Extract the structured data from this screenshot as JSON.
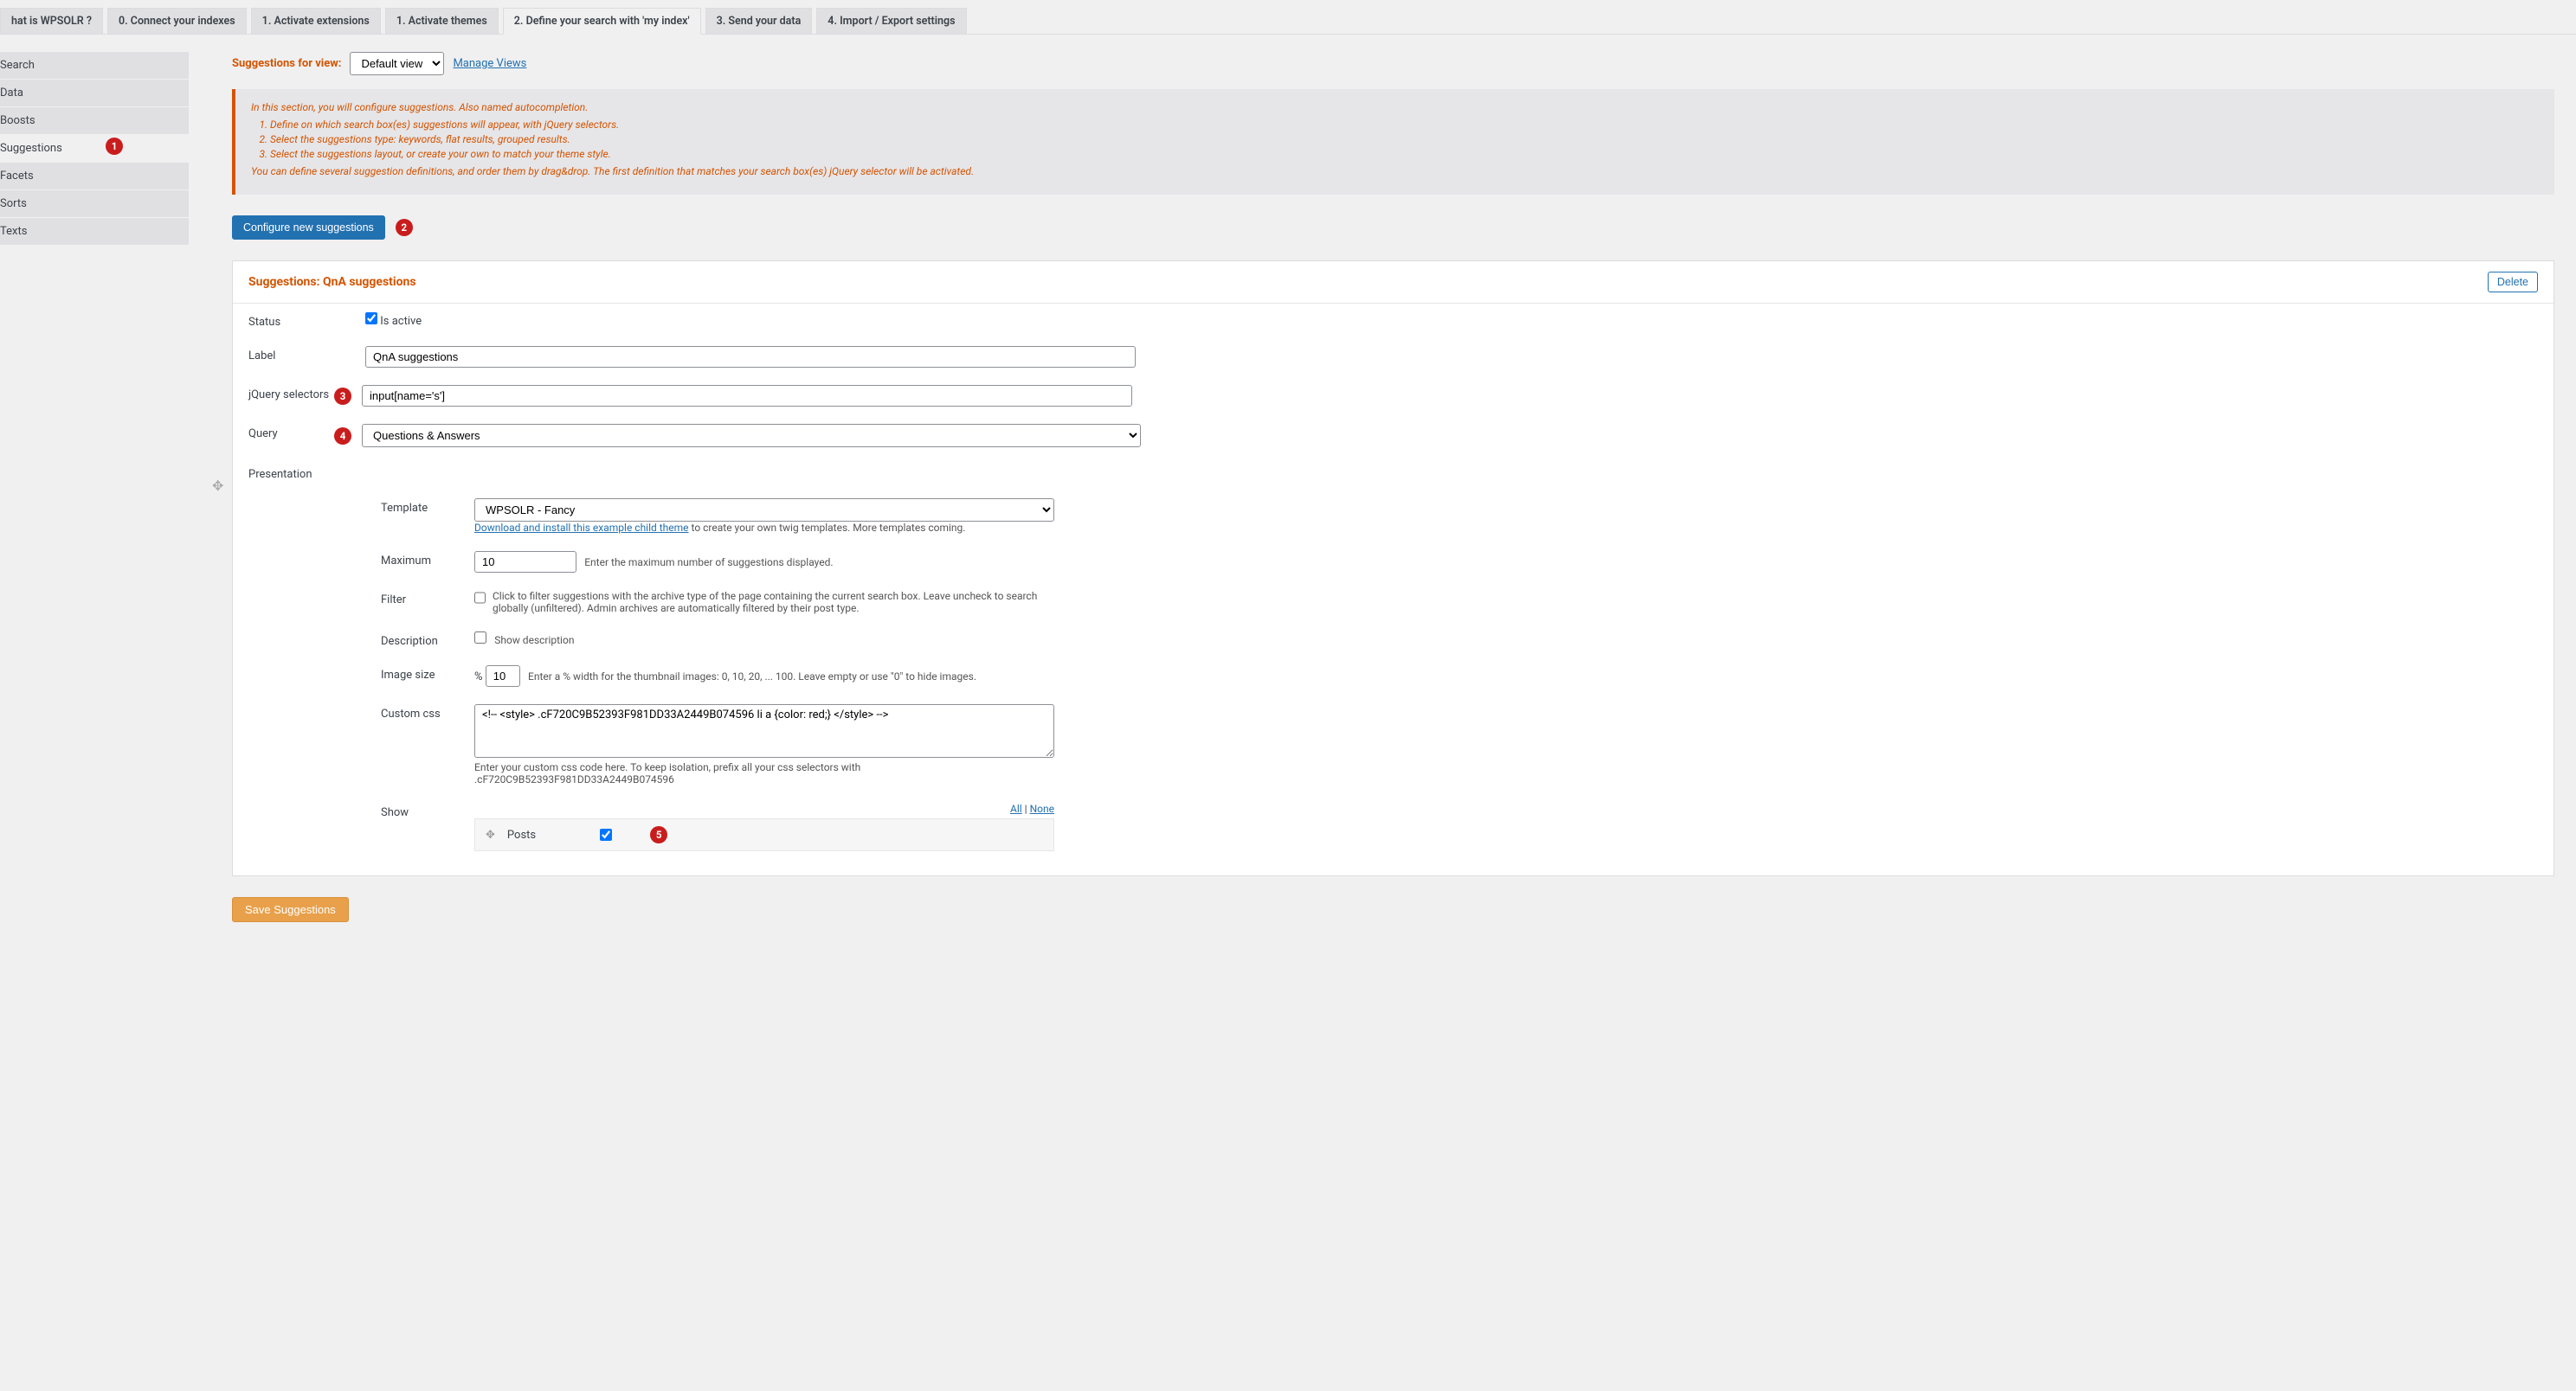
{
  "tabs": [
    "hat is WPSOLR ?",
    "0. Connect your indexes",
    "1. Activate extensions",
    "1. Activate themes",
    "2. Define your search with 'my index'",
    "3. Send your data",
    "4. Import / Export settings"
  ],
  "active_tab_index": 4,
  "sidebar": {
    "items": [
      "Search",
      "Data",
      "Boosts",
      "Suggestions",
      "Facets",
      "Sorts",
      "Texts"
    ],
    "active_index": 3
  },
  "badges": {
    "sidebar": "1",
    "configure": "2",
    "selectors": "3",
    "query": "4",
    "posts": "5"
  },
  "view": {
    "label": "Suggestions for view:",
    "selected": "Default view",
    "manage": "Manage Views"
  },
  "info": {
    "intro": "In this section, you will configure suggestions. Also named autocompletion.",
    "steps": [
      "Define on which search box(es) suggestions will appear, with jQuery selectors.",
      "Select the suggestions type: keywords, flat results, grouped results.",
      "Select the suggestions layout, or create your own to match your theme style."
    ],
    "note": "You can define several suggestion definitions, and order them by drag&drop. The first definition that matches your search box(es) jQuery selector will be activated."
  },
  "buttons": {
    "configure": "Configure new suggestions",
    "delete": "Delete",
    "save": "Save Suggestions"
  },
  "panel": {
    "title": "Suggestions: QnA suggestions",
    "status_label": "Status",
    "is_active_label": "Is active",
    "is_active": true,
    "label_label": "Label",
    "label_value": "QnA suggestions",
    "selectors_label": "jQuery selectors",
    "selectors_value": "input[name='s']",
    "query_label": "Query",
    "query_value": "Questions & Answers",
    "presentation_label": "Presentation",
    "template_label": "Template",
    "template_value": "WPSOLR - Fancy",
    "template_link": "Download and install this example child theme",
    "template_link_after": " to create your own twig templates. More templates coming.",
    "maximum_label": "Maximum",
    "maximum_value": "10",
    "maximum_desc": "Enter the maximum number of suggestions displayed.",
    "filter_label": "Filter",
    "filter_desc": "Click to filter suggestions with the archive type of the page containing the current search box. Leave uncheck to search globally (unfiltered). Admin archives are automatically filtered by their post type.",
    "description_label": "Description",
    "description_chk_label": "Show description",
    "imgsize_label": "Image size",
    "imgsize_prefix": "%",
    "imgsize_value": "10",
    "imgsize_desc": "Enter a % width for the thumbnail images: 0, 10, 20, ... 100. Leave empty or use \"0\" to hide images.",
    "css_label": "Custom css",
    "css_value": "<!-- <style> .cF720C9B52393F981DD33A2449B074596 li a {color: red;} </style> -->",
    "css_desc": "Enter your custom css code here. To keep isolation, prefix all your css selectors with .cF720C9B52393F981DD33A2449B074596",
    "show_label": "Show",
    "show_all": "All",
    "show_none": "None",
    "show_item": "Posts"
  }
}
